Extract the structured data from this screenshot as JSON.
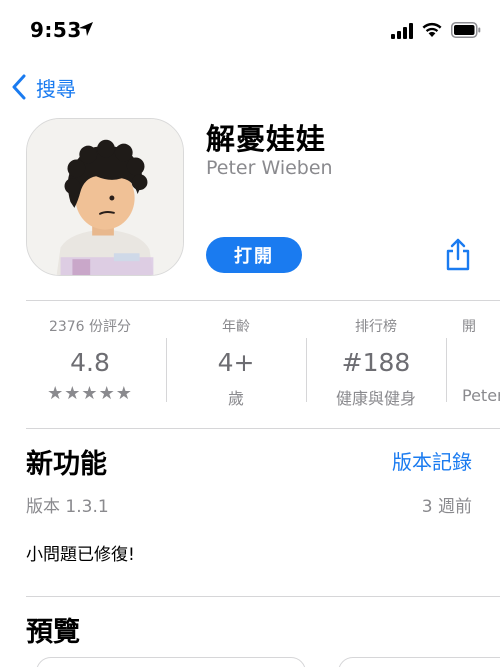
{
  "status_bar": {
    "time": "9:53"
  },
  "nav": {
    "back_label": "搜尋"
  },
  "app": {
    "title": "解憂娃娃",
    "developer": "Peter Wieben",
    "open_label": "打開"
  },
  "info": {
    "ratings": {
      "top": "2376 份評分",
      "value": "4.8",
      "stars": "★★★★★"
    },
    "age": {
      "top": "年齡",
      "value": "4+",
      "sub": "歲"
    },
    "chart": {
      "top": "排行榜",
      "value": "#188",
      "sub": "健康與健身"
    },
    "developer": {
      "top": "開",
      "sub": "Peter"
    }
  },
  "whats_new": {
    "title": "新功能",
    "version_history": "版本記錄",
    "version": "版本 1.3.1",
    "date": "3 週前",
    "notes": "小問題已修復!"
  },
  "preview": {
    "title": "預覽"
  },
  "colors": {
    "accent": "#1a7bf0",
    "secondary_text": "#8a8a8e"
  }
}
